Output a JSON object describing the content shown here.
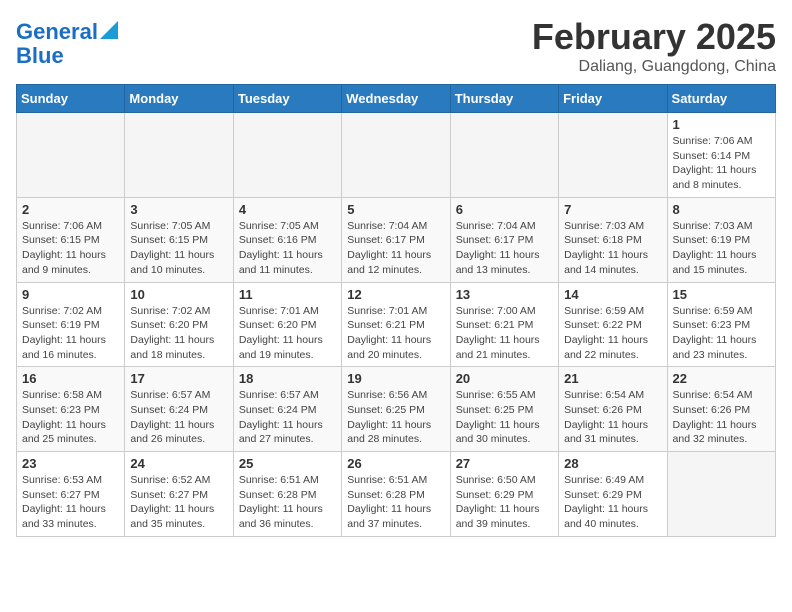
{
  "header": {
    "logo_line1": "General",
    "logo_line2": "Blue",
    "title": "February 2025",
    "subtitle": "Daliang, Guangdong, China"
  },
  "weekdays": [
    "Sunday",
    "Monday",
    "Tuesday",
    "Wednesday",
    "Thursday",
    "Friday",
    "Saturday"
  ],
  "weeks": [
    [
      {
        "day": "",
        "info": ""
      },
      {
        "day": "",
        "info": ""
      },
      {
        "day": "",
        "info": ""
      },
      {
        "day": "",
        "info": ""
      },
      {
        "day": "",
        "info": ""
      },
      {
        "day": "",
        "info": ""
      },
      {
        "day": "1",
        "info": "Sunrise: 7:06 AM\nSunset: 6:14 PM\nDaylight: 11 hours and 8 minutes."
      }
    ],
    [
      {
        "day": "2",
        "info": "Sunrise: 7:06 AM\nSunset: 6:15 PM\nDaylight: 11 hours and 9 minutes."
      },
      {
        "day": "3",
        "info": "Sunrise: 7:05 AM\nSunset: 6:15 PM\nDaylight: 11 hours and 10 minutes."
      },
      {
        "day": "4",
        "info": "Sunrise: 7:05 AM\nSunset: 6:16 PM\nDaylight: 11 hours and 11 minutes."
      },
      {
        "day": "5",
        "info": "Sunrise: 7:04 AM\nSunset: 6:17 PM\nDaylight: 11 hours and 12 minutes."
      },
      {
        "day": "6",
        "info": "Sunrise: 7:04 AM\nSunset: 6:17 PM\nDaylight: 11 hours and 13 minutes."
      },
      {
        "day": "7",
        "info": "Sunrise: 7:03 AM\nSunset: 6:18 PM\nDaylight: 11 hours and 14 minutes."
      },
      {
        "day": "8",
        "info": "Sunrise: 7:03 AM\nSunset: 6:19 PM\nDaylight: 11 hours and 15 minutes."
      }
    ],
    [
      {
        "day": "9",
        "info": "Sunrise: 7:02 AM\nSunset: 6:19 PM\nDaylight: 11 hours and 16 minutes."
      },
      {
        "day": "10",
        "info": "Sunrise: 7:02 AM\nSunset: 6:20 PM\nDaylight: 11 hours and 18 minutes."
      },
      {
        "day": "11",
        "info": "Sunrise: 7:01 AM\nSunset: 6:20 PM\nDaylight: 11 hours and 19 minutes."
      },
      {
        "day": "12",
        "info": "Sunrise: 7:01 AM\nSunset: 6:21 PM\nDaylight: 11 hours and 20 minutes."
      },
      {
        "day": "13",
        "info": "Sunrise: 7:00 AM\nSunset: 6:21 PM\nDaylight: 11 hours and 21 minutes."
      },
      {
        "day": "14",
        "info": "Sunrise: 6:59 AM\nSunset: 6:22 PM\nDaylight: 11 hours and 22 minutes."
      },
      {
        "day": "15",
        "info": "Sunrise: 6:59 AM\nSunset: 6:23 PM\nDaylight: 11 hours and 23 minutes."
      }
    ],
    [
      {
        "day": "16",
        "info": "Sunrise: 6:58 AM\nSunset: 6:23 PM\nDaylight: 11 hours and 25 minutes."
      },
      {
        "day": "17",
        "info": "Sunrise: 6:57 AM\nSunset: 6:24 PM\nDaylight: 11 hours and 26 minutes."
      },
      {
        "day": "18",
        "info": "Sunrise: 6:57 AM\nSunset: 6:24 PM\nDaylight: 11 hours and 27 minutes."
      },
      {
        "day": "19",
        "info": "Sunrise: 6:56 AM\nSunset: 6:25 PM\nDaylight: 11 hours and 28 minutes."
      },
      {
        "day": "20",
        "info": "Sunrise: 6:55 AM\nSunset: 6:25 PM\nDaylight: 11 hours and 30 minutes."
      },
      {
        "day": "21",
        "info": "Sunrise: 6:54 AM\nSunset: 6:26 PM\nDaylight: 11 hours and 31 minutes."
      },
      {
        "day": "22",
        "info": "Sunrise: 6:54 AM\nSunset: 6:26 PM\nDaylight: 11 hours and 32 minutes."
      }
    ],
    [
      {
        "day": "23",
        "info": "Sunrise: 6:53 AM\nSunset: 6:27 PM\nDaylight: 11 hours and 33 minutes."
      },
      {
        "day": "24",
        "info": "Sunrise: 6:52 AM\nSunset: 6:27 PM\nDaylight: 11 hours and 35 minutes."
      },
      {
        "day": "25",
        "info": "Sunrise: 6:51 AM\nSunset: 6:28 PM\nDaylight: 11 hours and 36 minutes."
      },
      {
        "day": "26",
        "info": "Sunrise: 6:51 AM\nSunset: 6:28 PM\nDaylight: 11 hours and 37 minutes."
      },
      {
        "day": "27",
        "info": "Sunrise: 6:50 AM\nSunset: 6:29 PM\nDaylight: 11 hours and 39 minutes."
      },
      {
        "day": "28",
        "info": "Sunrise: 6:49 AM\nSunset: 6:29 PM\nDaylight: 11 hours and 40 minutes."
      },
      {
        "day": "",
        "info": ""
      }
    ]
  ]
}
